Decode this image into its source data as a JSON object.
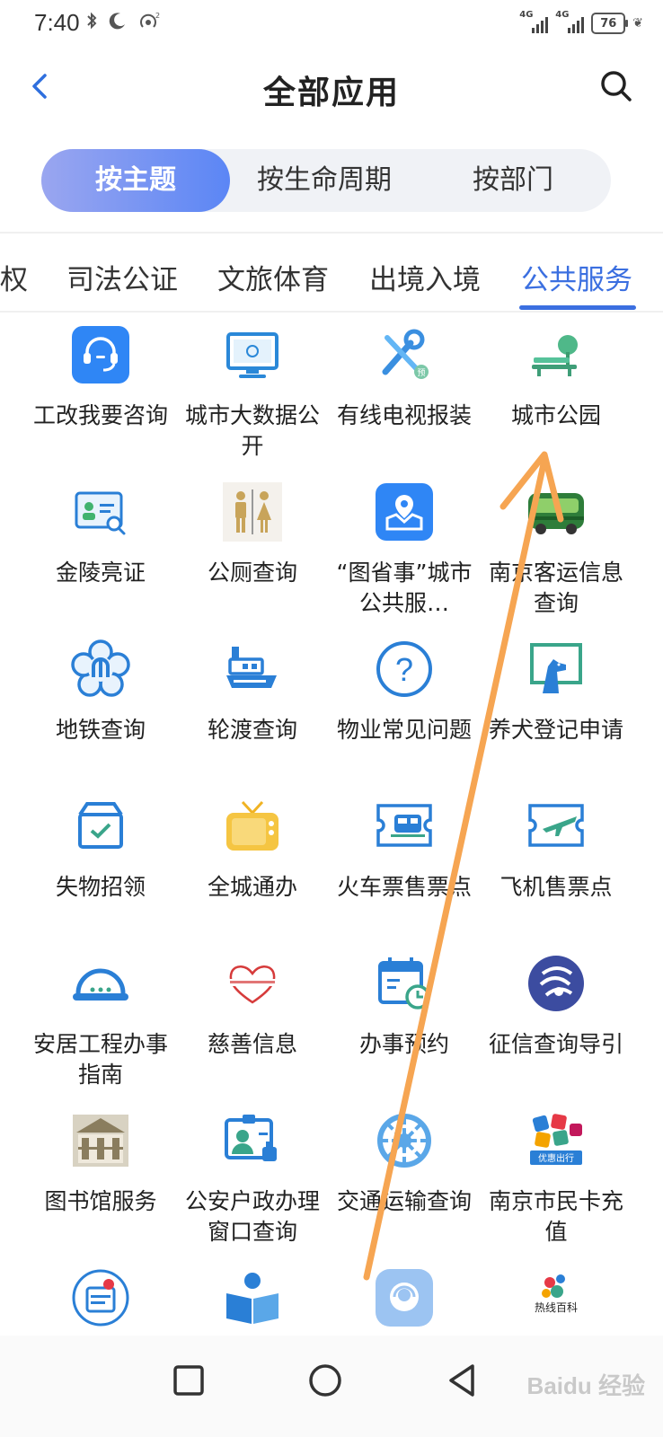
{
  "status_bar": {
    "time": "7:40",
    "network_label": "4G",
    "battery": "76"
  },
  "header": {
    "title": "全部应用"
  },
  "segments": [
    "按主题",
    "按生命周期",
    "按部门"
  ],
  "categories": [
    "权",
    "司法公证",
    "文旅体育",
    "出境入境",
    "公共服务"
  ],
  "apps": [
    {
      "label": "工改我要咨询",
      "icon": "headset-icon"
    },
    {
      "label": "城市大数据公开",
      "icon": "monitor-icon"
    },
    {
      "label": "有线电视报装",
      "icon": "tools-icon"
    },
    {
      "label": "城市公园",
      "icon": "park-bench-icon"
    },
    {
      "label": "金陵亮证",
      "icon": "id-card-search-icon"
    },
    {
      "label": "公厕查询",
      "icon": "toilet-icon"
    },
    {
      "label": "“图省事”城市公共服…",
      "icon": "map-pin-icon"
    },
    {
      "label": "南京客运信息查询",
      "icon": "bus-icon"
    },
    {
      "label": "地铁查询",
      "icon": "metro-logo-icon"
    },
    {
      "label": "轮渡查询",
      "icon": "ferry-icon"
    },
    {
      "label": "物业常见问题",
      "icon": "question-icon"
    },
    {
      "label": "养犬登记申请",
      "icon": "dog-icon"
    },
    {
      "label": "失物招领",
      "icon": "box-check-icon"
    },
    {
      "label": "全城通办",
      "icon": "tv-icon"
    },
    {
      "label": "火车票售票点",
      "icon": "train-ticket-icon"
    },
    {
      "label": "飞机售票点",
      "icon": "plane-ticket-icon"
    },
    {
      "label": "安居工程办事指南",
      "icon": "helmet-icon"
    },
    {
      "label": "慈善信息",
      "icon": "charity-heart-icon"
    },
    {
      "label": "办事预约",
      "icon": "calendar-icon"
    },
    {
      "label": "征信查询导引",
      "icon": "credit-logo-icon"
    },
    {
      "label": "图书馆服务",
      "icon": "library-icon"
    },
    {
      "label": "公安户政办理窗口查询",
      "icon": "badge-user-icon"
    },
    {
      "label": "交通运输查询",
      "icon": "wheel-icon"
    },
    {
      "label": "南京市民卡充值",
      "icon": "citizen-card-icon"
    },
    {
      "label": "",
      "icon": "food-icon"
    },
    {
      "label": "",
      "icon": "book-reader-icon"
    },
    {
      "label": "",
      "icon": "service-bubble-icon"
    },
    {
      "label": "",
      "icon": "hotline-logo-icon"
    }
  ],
  "icon_texts": {
    "citizen_card_tag": "优惠出行",
    "hotline_logo_text": "热线百科"
  },
  "watermark": "Baidu 经验",
  "colors": {
    "accent": "#3b6fe0",
    "arrow": "#f6a552"
  }
}
